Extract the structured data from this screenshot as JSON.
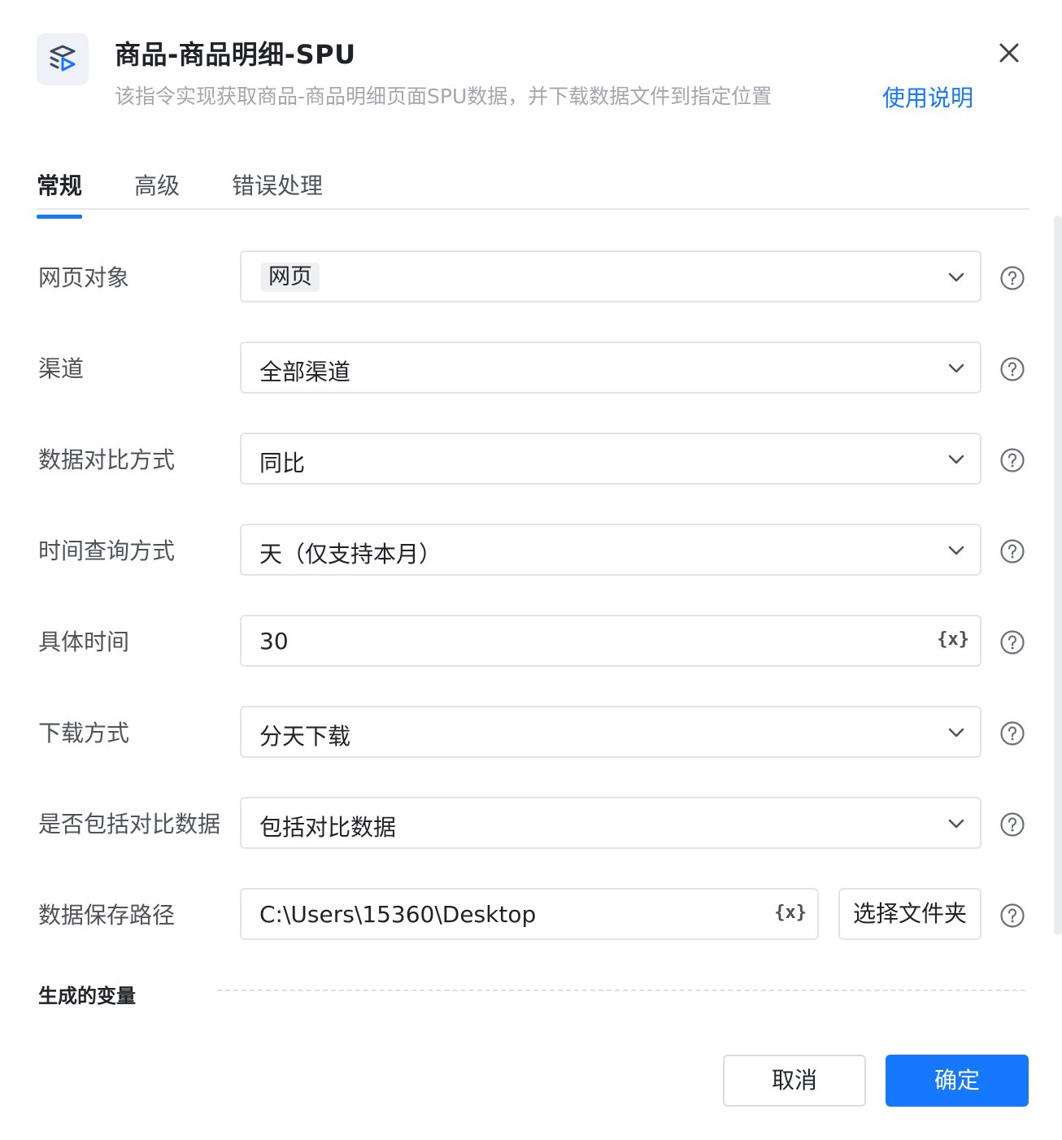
{
  "header": {
    "title": "商品-商品明细-SPU",
    "subtitle": "该指令实现获取商品-商品明细页面SPU数据，并下载数据文件到指定位置",
    "help_link": "使用说明",
    "icon": "layers-play-icon"
  },
  "tabs": [
    {
      "label": "常规",
      "active": true
    },
    {
      "label": "高级",
      "active": false
    },
    {
      "label": "错误处理",
      "active": false
    }
  ],
  "form": {
    "web_object": {
      "label": "网页对象",
      "value": "网页"
    },
    "channel": {
      "label": "渠道",
      "value": "全部渠道"
    },
    "compare_mode": {
      "label": "数据对比方式",
      "value": "同比"
    },
    "time_query_mode": {
      "label": "时间查询方式",
      "value": "天（仅支持本月）"
    },
    "specific_time": {
      "label": "具体时间",
      "value": "30",
      "var_icon": "{x}"
    },
    "download_mode": {
      "label": "下载方式",
      "value": "分天下载"
    },
    "include_compare": {
      "label": "是否包括对比数据",
      "value": "包括对比数据"
    },
    "save_path": {
      "label": "数据保存路径",
      "value": "C:\\Users\\15360\\Desktop",
      "var_icon": "{x}",
      "folder_button": "选择文件夹"
    }
  },
  "generated_vars": {
    "label": "生成的变量"
  },
  "footer": {
    "cancel": "取消",
    "ok": "确定"
  },
  "colors": {
    "accent": "#1677ff",
    "border": "#e1e4e8",
    "label": "#4d525b",
    "muted": "#a2a7b0"
  }
}
